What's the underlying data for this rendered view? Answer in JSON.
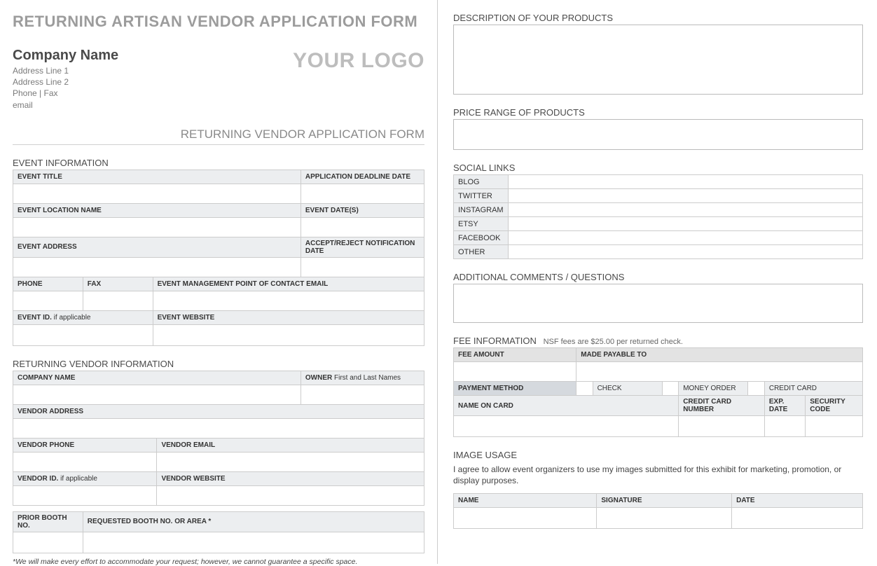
{
  "left": {
    "main_title": "RETURNING ARTISAN VENDOR APPLICATION FORM",
    "company": {
      "name": "Company Name",
      "addr1": "Address Line 1",
      "addr2": "Address Line 2",
      "phone_fax": "Phone | Fax",
      "email": "email"
    },
    "logo": "YOUR LOGO",
    "subtitle": "RETURNING VENDOR APPLICATION FORM",
    "event_info": {
      "section": "EVENT INFORMATION",
      "title": "EVENT TITLE",
      "deadline": "APPLICATION DEADLINE DATE",
      "location": "EVENT LOCATION NAME",
      "dates": "EVENT DATE(S)",
      "address": "EVENT ADDRESS",
      "notify": "ACCEPT/REJECT NOTIFICATION DATE",
      "phone": "PHONE",
      "fax": "FAX",
      "poc_email": "EVENT MANAGEMENT POINT OF CONTACT EMAIL",
      "event_id": "EVENT ID.",
      "if_applicable": " if applicable",
      "website": "EVENT WEBSITE"
    },
    "vendor_info": {
      "section": "RETURNING VENDOR INFORMATION",
      "company": "COMPANY NAME",
      "owner": "OWNER",
      "owner_hint": "  First and Last Names",
      "addr": "VENDOR ADDRESS",
      "phone": "VENDOR PHONE",
      "email": "VENDOR EMAIL",
      "vendor_id": "VENDOR ID.",
      "if_applicable": " if applicable",
      "website": "VENDOR WEBSITE",
      "prior_booth": "PRIOR BOOTH NO.",
      "req_booth": "REQUESTED BOOTH NO. OR AREA *",
      "footnote": "*We will make every effort to accommodate your request; however, we cannot guarantee a specific space."
    }
  },
  "right": {
    "desc_label": "DESCRIPTION OF YOUR PRODUCTS",
    "price_label": "PRICE RANGE OF PRODUCTS",
    "social": {
      "label": "SOCIAL LINKS",
      "rows": [
        "BLOG",
        "TWITTER",
        "INSTAGRAM",
        "ETSY",
        "FACEBOOK",
        "OTHER"
      ]
    },
    "addl_label": "ADDITIONAL COMMENTS / QUESTIONS",
    "fee": {
      "label": "FEE INFORMATION",
      "hint": "NSF fees are $25.00 per returned check.",
      "amount": "FEE AMOUNT",
      "payable": "MADE PAYABLE TO",
      "method": "PAYMENT METHOD",
      "check": "CHECK",
      "money_order": "MONEY ORDER",
      "credit_card": "CREDIT CARD",
      "name_on_card": "NAME ON CARD",
      "cc_number": "CREDIT CARD NUMBER",
      "exp": "EXP. DATE",
      "sec": "SECURITY CODE"
    },
    "image_usage": {
      "label": "IMAGE USAGE",
      "text": "I agree to allow event organizers to use my images submitted for this exhibit for marketing, promotion, or display purposes.",
      "name": "NAME",
      "signature": "SIGNATURE",
      "date": "DATE"
    }
  }
}
